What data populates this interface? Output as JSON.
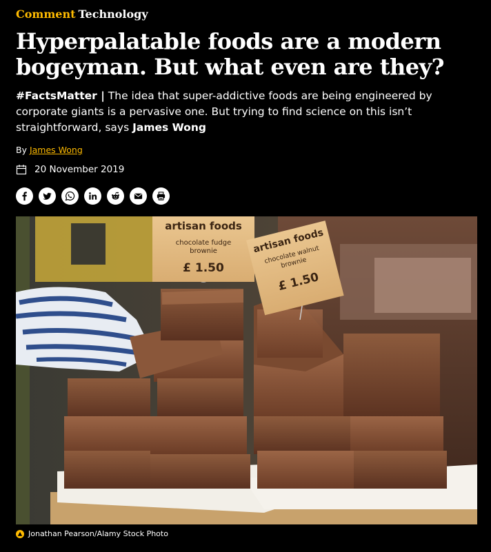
{
  "kicker": {
    "section": "Comment",
    "topic": "Technology"
  },
  "headline": "Hyperpalatable foods are a modern bogeyman. But what even are they?",
  "standfirst": {
    "tag": "#FactsMatter |",
    "text": " The idea that super-addictive foods are being engineered by corporate giants is a pervasive one. But trying to find science on this isn’t straightforward, says ",
    "author": "James Wong"
  },
  "byline": {
    "prefix": "By ",
    "author": "James Wong"
  },
  "date": "20 November 2019",
  "share_icons": [
    "facebook-icon",
    "twitter-icon",
    "whatsapp-icon",
    "linkedin-icon",
    "reddit-icon",
    "email-icon",
    "print-icon"
  ],
  "photo": {
    "sign_left": {
      "title": "artisan foods",
      "line1": "chocolate fudge",
      "line2": "brownie",
      "price": "£ 1.50"
    },
    "sign_right": {
      "title": "artisan foods",
      "line1": "chocolate walnut",
      "line2": "brownie",
      "price": "£ 1.50"
    }
  },
  "caption": "Jonathan Pearson/Alamy Stock Photo",
  "colors": {
    "accent": "#ffbb00",
    "background": "#000000"
  }
}
